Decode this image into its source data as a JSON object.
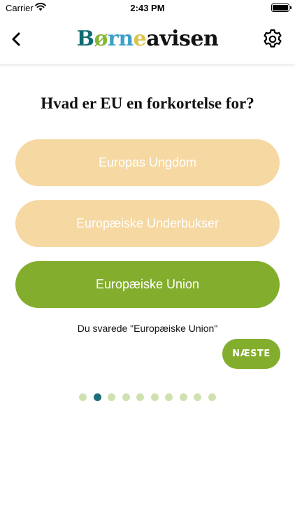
{
  "status_bar": {
    "carrier": "Carrier",
    "time": "2:43 PM"
  },
  "nav": {
    "logo": {
      "b": "B",
      "o": "ø",
      "rn": "rn",
      "e": "e",
      "rest": "avisen"
    }
  },
  "quiz": {
    "question": "Hvad er EU en forkortelse for?",
    "answers": [
      {
        "label": "Europas Ungdom",
        "state": "dim"
      },
      {
        "label": "Europæiske Underbukser",
        "state": "dim"
      },
      {
        "label": "Europæiske Union",
        "state": "correct"
      }
    ],
    "feedback": "Du svarede \"Europæiske Union\"",
    "next_label": "NÆSTE",
    "progress": {
      "total": 10,
      "current": 2
    }
  },
  "colors": {
    "accent_green": "#83ad2c",
    "answer_dim": "#f5d8a2",
    "dot_active": "#1e6e7a",
    "dot_inactive": "#cfe1b0"
  }
}
